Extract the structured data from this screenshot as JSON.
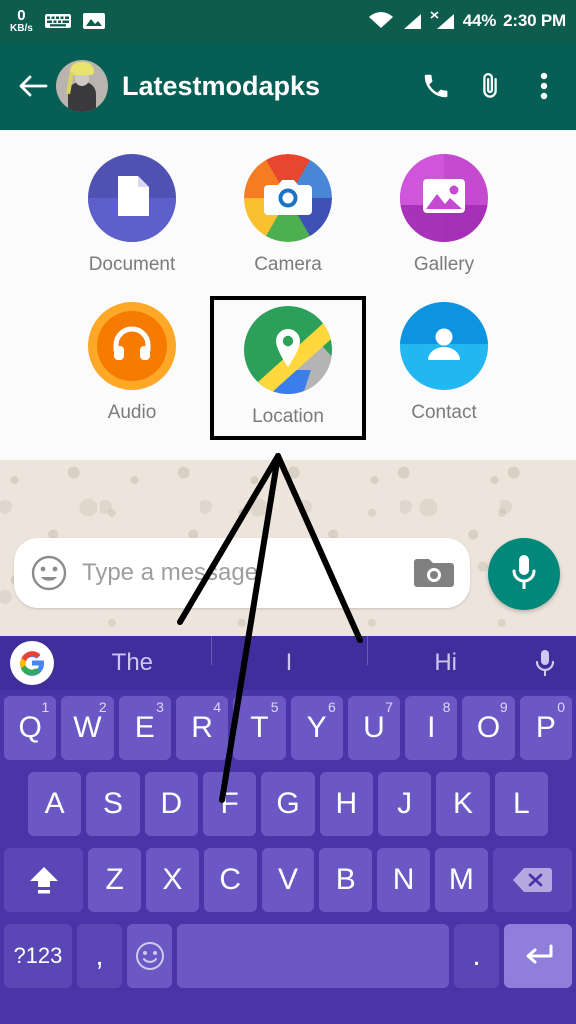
{
  "status_bar": {
    "net_speed_value": "0",
    "net_speed_unit": "KB/s",
    "battery": "44%",
    "time": "2:30 PM",
    "icons": [
      "keyboard-icon",
      "image-icon",
      "wifi-icon",
      "signal-icon",
      "signal-no-sim-icon"
    ]
  },
  "header": {
    "back_icon": "back-arrow-icon",
    "title": "Latestmodapks",
    "call_icon": "phone-icon",
    "attach_icon": "paperclip-icon",
    "menu_icon": "overflow-menu-icon"
  },
  "attachment_panel": {
    "items": [
      {
        "label": "Document",
        "icon": "document-icon",
        "color": "#4f52b2",
        "highlighted": false
      },
      {
        "label": "Camera",
        "icon": "camera-icon",
        "color": "#e8462f",
        "highlighted": false
      },
      {
        "label": "Gallery",
        "icon": "gallery-icon",
        "color": "#c44ad0",
        "highlighted": false
      },
      {
        "label": "Audio",
        "icon": "headphones-icon",
        "color": "#ffa726",
        "highlighted": false
      },
      {
        "label": "Location",
        "icon": "map-pin-icon",
        "color": "#2ca05a",
        "highlighted": true
      },
      {
        "label": "Contact",
        "icon": "person-icon",
        "color": "#24b6f0",
        "highlighted": false
      }
    ]
  },
  "input_bar": {
    "emoji_icon": "emoji-smiley-icon",
    "placeholder": "Type a message",
    "value": "",
    "camera_icon": "camera-icon",
    "mic_icon": "microphone-icon"
  },
  "keyboard": {
    "google_icon": "google-logo-icon",
    "suggestions": [
      "The",
      "I",
      "Hi"
    ],
    "voice_icon": "microphone-icon",
    "row1": [
      {
        "key": "Q",
        "num": "1"
      },
      {
        "key": "W",
        "num": "2"
      },
      {
        "key": "E",
        "num": "3"
      },
      {
        "key": "R",
        "num": "4"
      },
      {
        "key": "T",
        "num": "5"
      },
      {
        "key": "Y",
        "num": "6"
      },
      {
        "key": "U",
        "num": "7"
      },
      {
        "key": "I",
        "num": "8"
      },
      {
        "key": "O",
        "num": "9"
      },
      {
        "key": "P",
        "num": "0"
      }
    ],
    "row2": [
      "A",
      "S",
      "D",
      "F",
      "G",
      "H",
      "J",
      "K",
      "L"
    ],
    "row3": [
      "Z",
      "X",
      "C",
      "V",
      "B",
      "N",
      "M"
    ],
    "shift_icon": "shift-caps-icon",
    "backspace_icon": "backspace-icon",
    "row4": {
      "symbols": "?123",
      "comma": ",",
      "emoji_icon": "emoji-smiley-icon",
      "space": "",
      "period": ".",
      "enter_icon": "enter-return-icon"
    }
  },
  "annotation": {
    "type": "hand-drawn-arrows",
    "color": "#000000",
    "target": "Location"
  },
  "colors": {
    "status_bar": "#0d5c4d",
    "header": "#075e54",
    "wallpaper": "#ede4dc",
    "keyboard_bg": "#4a35a8",
    "key": "#6b58c4",
    "suggestion_bg": "#3f2e9b",
    "mic_fab": "#00897b"
  }
}
